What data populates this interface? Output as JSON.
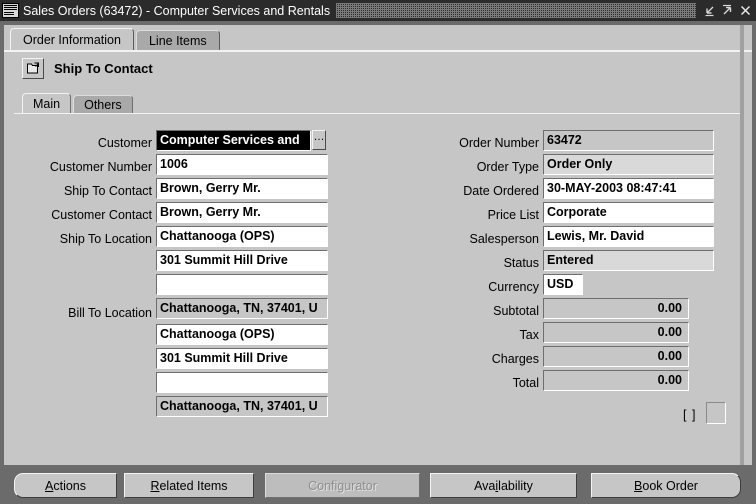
{
  "window": {
    "title": "Sales Orders (63472) - Computer Services and Rentals",
    "app_icon": "oracle-app-icon",
    "controls": [
      {
        "name": "minimize-button",
        "icon": "minimize-icon"
      },
      {
        "name": "maximize-button",
        "icon": "maximize-icon"
      },
      {
        "name": "close-button",
        "icon": "close-icon"
      }
    ]
  },
  "top_tabs": [
    {
      "label": "Order Information",
      "active": true
    },
    {
      "label": "Line Items",
      "active": false
    }
  ],
  "region": {
    "icon": "open-folder-icon",
    "title": "Ship To Contact"
  },
  "sub_tabs": [
    {
      "label": "Main",
      "active": true
    },
    {
      "label": "Others",
      "active": false
    }
  ],
  "left_fields": {
    "customer": {
      "label": "Customer",
      "value": "Computer Services and",
      "state": "selected",
      "lov": "…"
    },
    "customer_number": {
      "label": "Customer Number",
      "value": "1006"
    },
    "ship_to_contact": {
      "label": "Ship To Contact",
      "value": "Brown, Gerry Mr."
    },
    "customer_contact": {
      "label": "Customer Contact",
      "value": "Brown, Gerry Mr."
    },
    "ship_to_location": {
      "label": "Ship To Location",
      "line1": "Chattanooga (OPS)",
      "line2": "301 Summit Hill Drive",
      "line3": "",
      "line4": "Chattanooga, TN, 37401, U"
    },
    "bill_to_location": {
      "label": "Bill To Location",
      "line1": "Chattanooga (OPS)",
      "line2": "301 Summit Hill Drive",
      "line3": "",
      "line4": "Chattanooga, TN, 37401, U"
    }
  },
  "right_fields": {
    "order_number": {
      "label": "Order Number",
      "value": "63472"
    },
    "order_type": {
      "label": "Order Type",
      "value": "Order Only"
    },
    "date_ordered": {
      "label": "Date Ordered",
      "value": "30-MAY-2003 08:47:41"
    },
    "price_list": {
      "label": "Price List",
      "value": "Corporate"
    },
    "salesperson": {
      "label": "Salesperson",
      "value": "Lewis, Mr. David"
    },
    "status": {
      "label": "Status",
      "value": "Entered"
    },
    "currency": {
      "label": "Currency",
      "value": "USD"
    },
    "subtotal": {
      "label": "Subtotal",
      "value": "0.00"
    },
    "tax": {
      "label": "Tax",
      "value": "0.00"
    },
    "charges": {
      "label": "Charges",
      "value": "0.00"
    },
    "total": {
      "label": "Total",
      "value": "0.00"
    }
  },
  "descriptive_flexfield": {
    "bracket": "[ ]"
  },
  "buttons": [
    {
      "name": "actions-button",
      "prefix": "",
      "accel": "A",
      "suffix": "ctions",
      "disabled": false
    },
    {
      "name": "related-items-button",
      "prefix": "",
      "accel": "R",
      "suffix": "elated Items",
      "disabled": false
    },
    {
      "name": "configurator-button",
      "prefix": "Confi",
      "accel": "g",
      "suffix": "urator",
      "disabled": true
    },
    {
      "name": "availability-button",
      "prefix": "Ava",
      "accel": "i",
      "suffix": "lability",
      "disabled": false
    },
    {
      "name": "book-order-button",
      "prefix": "",
      "accel": "B",
      "suffix": "ook Order",
      "disabled": false
    }
  ],
  "colors": {
    "desktop": "#6b6b6b",
    "canvas": "#c6c6c6",
    "titlebar": "#2b2b2b",
    "field_white": "#ffffff",
    "field_readonly": "#c6c6c6",
    "selection_bg": "#000000",
    "selection_fg": "#ffffff"
  }
}
